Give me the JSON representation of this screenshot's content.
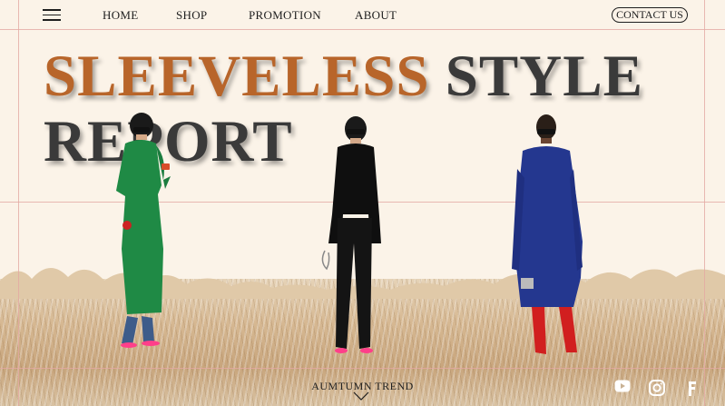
{
  "nav": {
    "menu_icon": "hamburger-menu-icon",
    "items": [
      {
        "label": "HOME"
      },
      {
        "label": "SHOP"
      },
      {
        "label": "PROMOTION"
      },
      {
        "label": "ABOUT"
      }
    ],
    "contact_label": "CONTACT US"
  },
  "hero": {
    "title_accent": "SLEEVELESS",
    "title_rest": "STYLE",
    "title_line2": "REPORT",
    "accent_color": "#b8652a",
    "dark_color": "#3a3a3a"
  },
  "footer": {
    "trend_label": "AUMTUMN TREND",
    "social": [
      {
        "icon": "youtube-icon"
      },
      {
        "icon": "instagram-icon"
      },
      {
        "icon": "facebook-icon"
      }
    ]
  }
}
